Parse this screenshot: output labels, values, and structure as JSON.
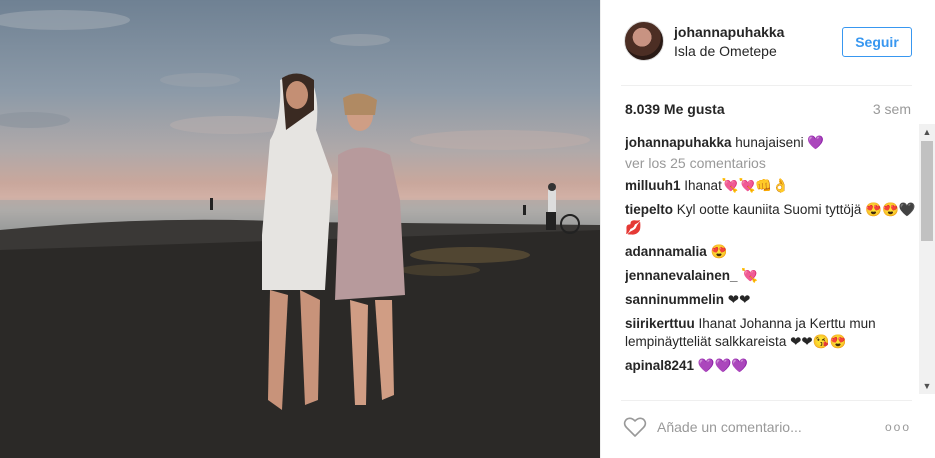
{
  "post": {
    "username": "johannapuhakka",
    "location": "Isla de Ometepe",
    "follow_label": "Seguir",
    "likes": "8.039 Me gusta",
    "time_ago": "3 sem",
    "view_all": "ver los 25 comentarios",
    "add_comment_placeholder": "Añade un comentario...",
    "more_label": "ooo"
  },
  "comments": [
    {
      "user": "johannapuhakka",
      "text": "hunajaiseni 💜"
    },
    {
      "user": "milluuh1",
      "text": "Ihanat💘💘👊👌"
    },
    {
      "user": "tiepelto",
      "text": "Kyl ootte kauniita Suomi tyttöjä 😍😍🖤💋"
    },
    {
      "user": "adannamalia",
      "text": "😍"
    },
    {
      "user": "jennanevalainen_",
      "text": "💘"
    },
    {
      "user": "sanninummelin",
      "text": "❤❤"
    },
    {
      "user": "siirikerttuu",
      "text": "Ihanat Johanna ja Kerttu mun lempinäytteliät salkkareista ❤❤😘😍"
    },
    {
      "user": "apinal8241",
      "text": "💜💜💜"
    }
  ],
  "colors": {
    "accent": "#3897f0",
    "muted": "#999999",
    "border": "#efefef"
  }
}
